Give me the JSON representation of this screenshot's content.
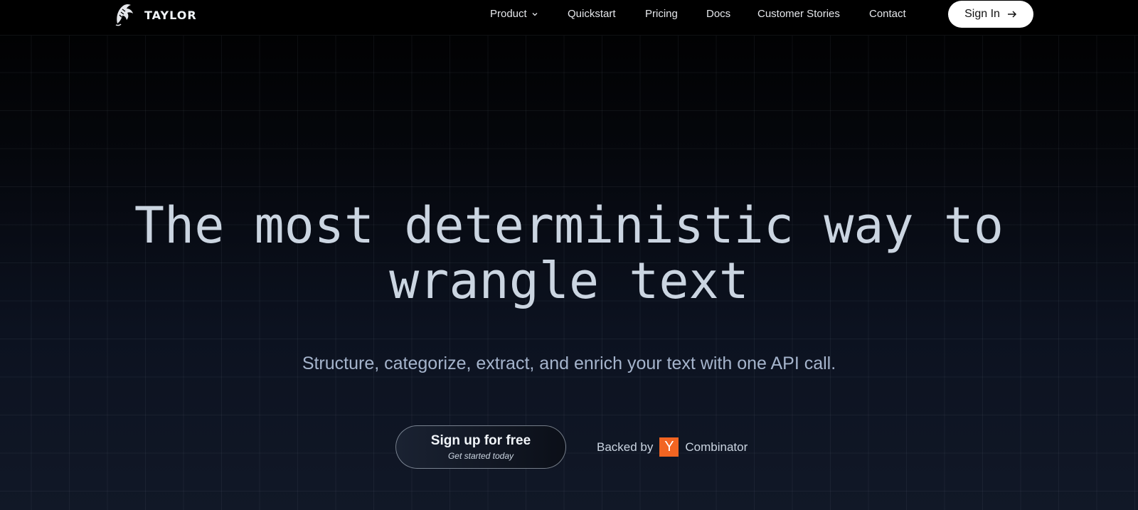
{
  "brand": {
    "name": "TAYLOR",
    "logo_icon": "dolphin-icon"
  },
  "nav": {
    "links": [
      {
        "label": "Product",
        "has_dropdown": true
      },
      {
        "label": "Quickstart"
      },
      {
        "label": "Pricing"
      },
      {
        "label": "Docs"
      },
      {
        "label": "Customer Stories"
      },
      {
        "label": "Contact"
      }
    ],
    "signin_label": "Sign In",
    "signin_icon": "arrow-right-icon"
  },
  "hero": {
    "title_line1": "The most deterministic way to",
    "title_line2": "wrangle text",
    "subtitle": "Structure, categorize, extract, and enrich your text with one API call.",
    "cta_label": "Sign up for free",
    "cta_sublabel": "Get started today",
    "backed_by": "Backed by",
    "backer_logo_letter": "Y",
    "backer_name": "Combinator"
  },
  "colors": {
    "accent_yc": "#f26522",
    "title_text": "#cbd5e1",
    "background_top": "#000000",
    "background_bottom": "#111827"
  }
}
